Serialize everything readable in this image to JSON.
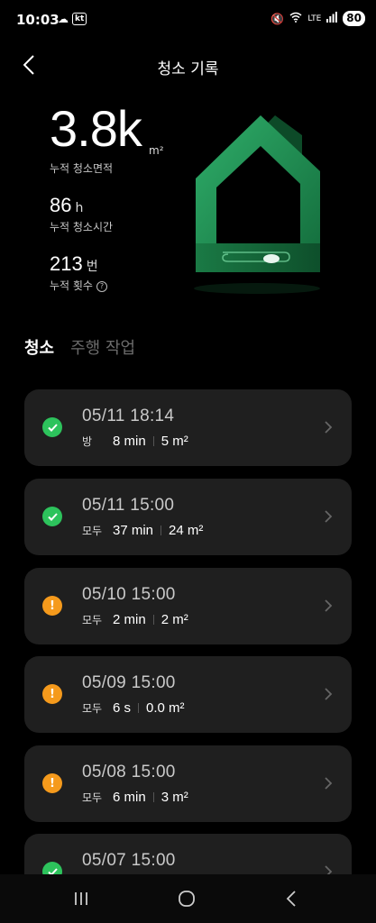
{
  "status_bar": {
    "time": "10:03",
    "carrier": "kt",
    "battery": "80",
    "lte": "LTE"
  },
  "header": {
    "title": "청소 기록"
  },
  "stats": {
    "area_value": "3.8k",
    "area_unit": "m²",
    "area_label": "누적 청소면적",
    "time_value": "86",
    "time_unit": "h",
    "time_label": "누적 청소시간",
    "count_value": "213",
    "count_unit": "번",
    "count_label": "누적 횟수"
  },
  "tabs": [
    {
      "label": "청소",
      "active": true
    },
    {
      "label": "주행 작업",
      "active": false
    }
  ],
  "records": [
    {
      "date": "05/11  18:14",
      "room": "방",
      "duration": "8 min",
      "area": "5 m²",
      "status": "success"
    },
    {
      "date": "05/11  15:00",
      "room": "모두",
      "duration": "37 min",
      "area": "24 m²",
      "status": "success"
    },
    {
      "date": "05/10  15:00",
      "room": "모두",
      "duration": "2 min",
      "area": "2 m²",
      "status": "warning"
    },
    {
      "date": "05/09  15:00",
      "room": "모두",
      "duration": "6 s",
      "area": "0.0 m²",
      "status": "warning"
    },
    {
      "date": "05/08  15:00",
      "room": "모두",
      "duration": "6 min",
      "area": "3 m²",
      "status": "warning"
    },
    {
      "date": "05/07  15:00",
      "room": "",
      "duration": "",
      "area": "",
      "status": "success"
    }
  ],
  "colors": {
    "success": "#2dc35c",
    "warning": "#f59a1c",
    "card": "#1f1f1f",
    "house": "#1f8a4f"
  }
}
